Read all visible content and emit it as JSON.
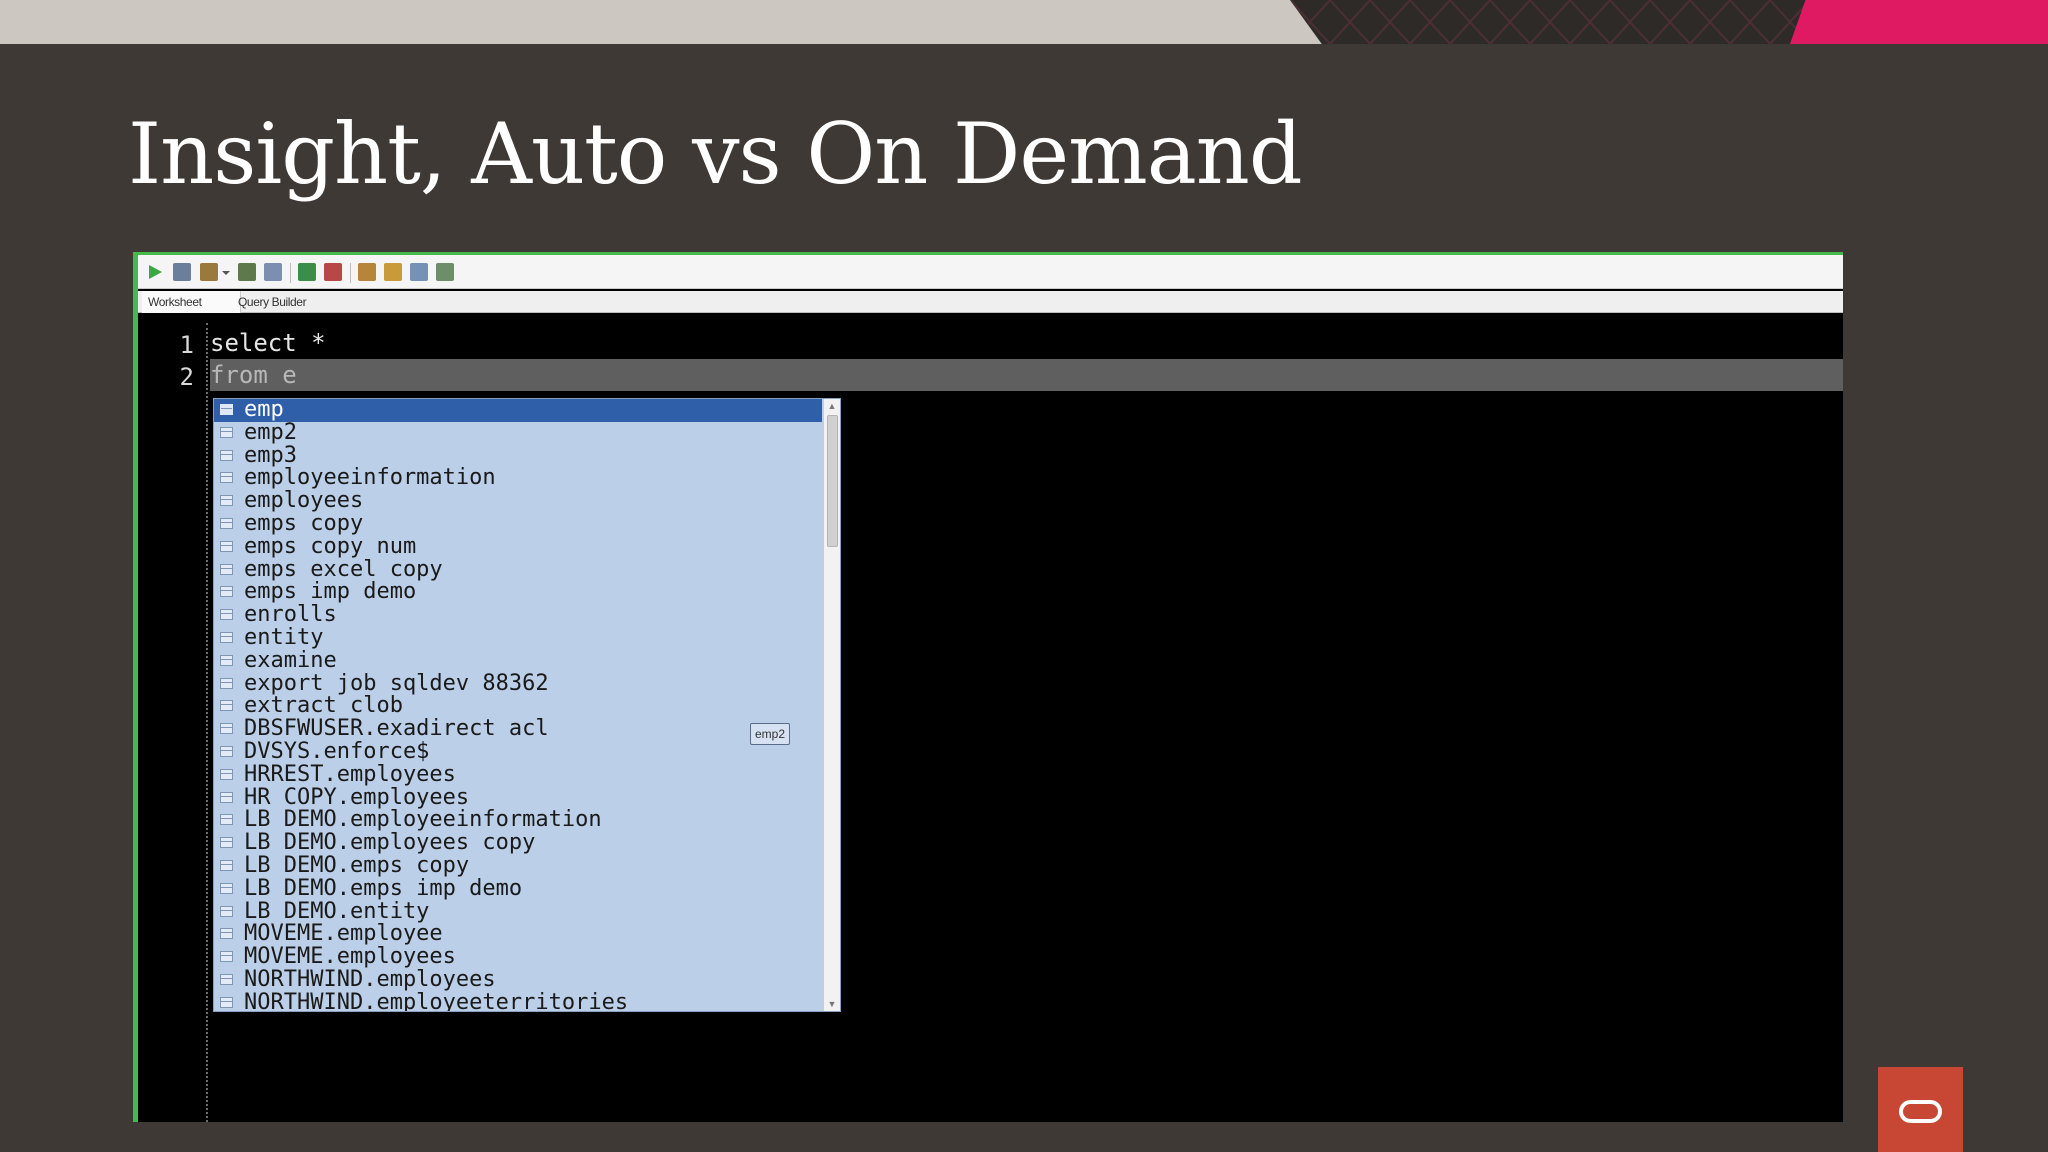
{
  "slide": {
    "title": "Insight, Auto vs On Demand"
  },
  "ide": {
    "toolbar_icons": [
      "run-statement-icon",
      "save-icon",
      "commit-icon",
      "dropdown-arrow-icon",
      "explain-plan-icon",
      "autotrace-icon",
      "commit-transaction-icon",
      "rollback-icon",
      "sql-tuning-icon",
      "clear-icon",
      "history-icon",
      "format-icon"
    ],
    "tabs": [
      "Worksheet",
      "Query Builder"
    ],
    "editor": {
      "lines": [
        {
          "num": "1",
          "text": "select *"
        },
        {
          "num": "2",
          "text": "from e"
        }
      ]
    },
    "autocomplete": {
      "selected_index": 0,
      "items": [
        "emp",
        "emp2",
        "emp3",
        "employeeinformation",
        "employees",
        "emps copy",
        "emps copy num",
        "emps excel copy",
        "emps imp demo",
        "enrolls",
        "entity",
        "examine",
        "export job sqldev 88362",
        "extract clob",
        "DBSFWUSER.exadirect acl",
        "DVSYS.enforce$",
        "HRREST.employees",
        "HR COPY.employees",
        "LB DEMO.employeeinformation",
        "LB DEMO.employees copy",
        "LB DEMO.emps copy",
        "LB DEMO.emps imp demo",
        "LB DEMO.entity",
        "MOVEME.employee",
        "MOVEME.employees",
        "NORTHWIND.employees",
        "NORTHWIND.employeeterritories"
      ],
      "tooltip": "emp2"
    }
  },
  "colors": {
    "background": "#3f3935",
    "accent_pink": "#e01a62",
    "ide_border": "#47b84b",
    "selection": "#2f5fa8",
    "popup_bg": "#bccfe8",
    "oracle_red": "#c74634"
  }
}
